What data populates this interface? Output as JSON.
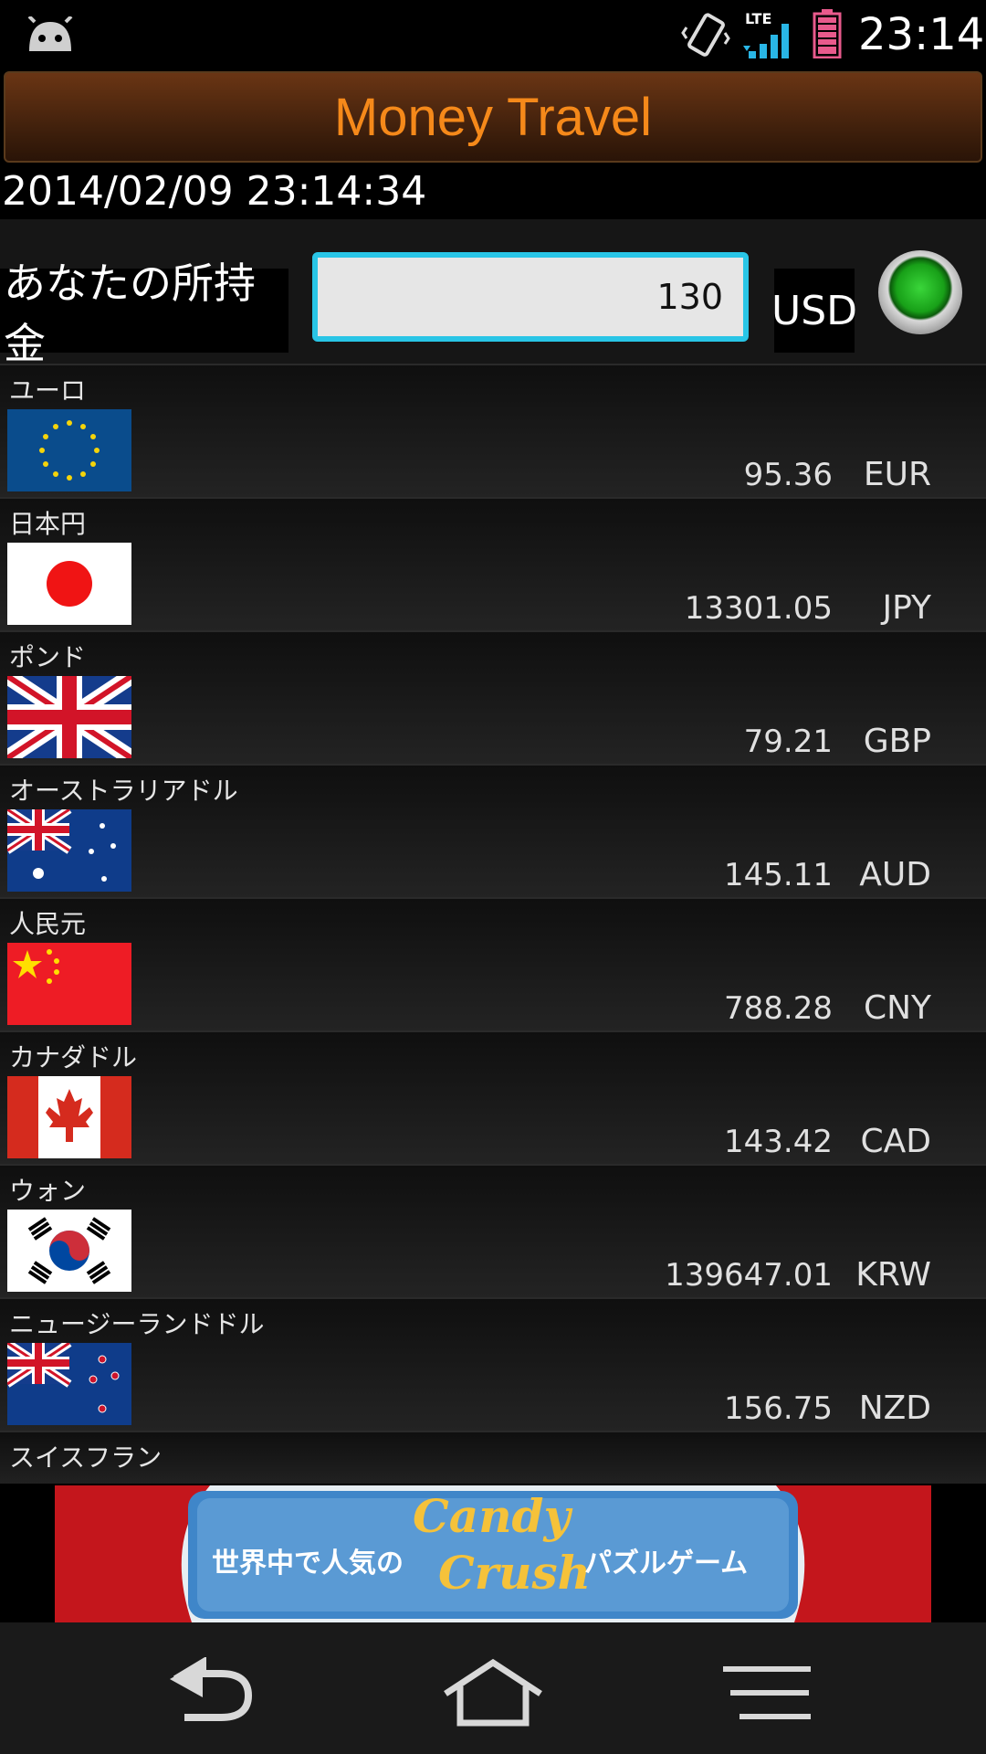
{
  "status_bar": {
    "time": "23:14",
    "icons": [
      "android-icon",
      "vibrate-icon",
      "lte-signal-icon",
      "battery-icon"
    ]
  },
  "app": {
    "title": "Money Travel",
    "datetime": "2014/02/09 23:14:34"
  },
  "input": {
    "label": "あなたの所持金",
    "amount": "130",
    "currency": "USD"
  },
  "currencies": [
    {
      "name": "ユーロ",
      "value": "95.36",
      "code": "EUR",
      "flag": "eu-flag-icon"
    },
    {
      "name": "日本円",
      "value": "13301.05",
      "code": "JPY",
      "flag": "japan-flag-icon"
    },
    {
      "name": "ポンド",
      "value": "79.21",
      "code": "GBP",
      "flag": "uk-flag-icon"
    },
    {
      "name": "オーストラリアドル",
      "value": "145.11",
      "code": "AUD",
      "flag": "australia-flag-icon"
    },
    {
      "name": "人民元",
      "value": "788.28",
      "code": "CNY",
      "flag": "china-flag-icon"
    },
    {
      "name": "カナダドル",
      "value": "143.42",
      "code": "CAD",
      "flag": "canada-flag-icon"
    },
    {
      "name": "ウォン",
      "value": "139647.01",
      "code": "KRW",
      "flag": "korea-flag-icon"
    },
    {
      "name": "ニュージーランドドル",
      "value": "156.75",
      "code": "NZD",
      "flag": "new-zealand-flag-icon"
    },
    {
      "name": "スイスフラン",
      "value": "",
      "code": "",
      "flag": "switzerland-flag-icon"
    }
  ],
  "ad": {
    "left_text": "世界中で人気の",
    "logo_line1": "Candy",
    "logo_line2": "Crush",
    "right_text": "パズルゲーム"
  },
  "navbar": {
    "icons": [
      "back-icon",
      "home-icon",
      "menu-icon"
    ]
  },
  "colors": {
    "title": "#f5891a",
    "input_border": "#29c5e6",
    "convert_button": "#18a018"
  }
}
